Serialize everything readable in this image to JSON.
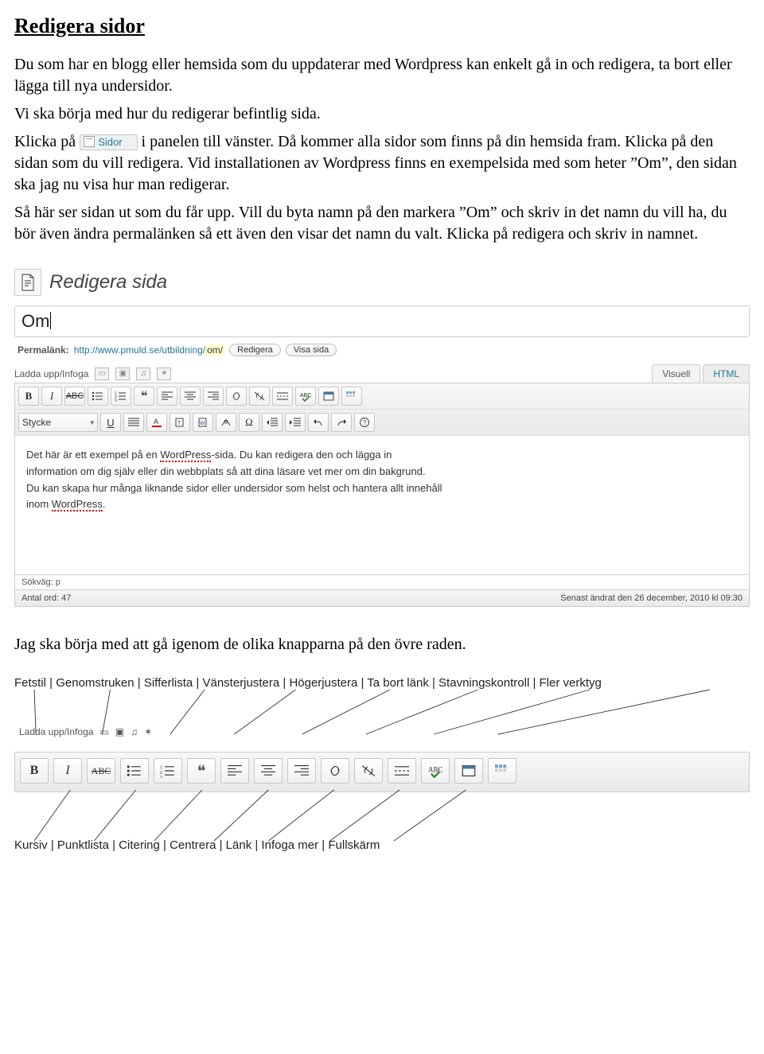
{
  "doc": {
    "heading": "Redigera sidor",
    "p1": "Du som  har en blogg eller hemsida som du uppdaterar med Wordpress kan enkelt gå in och redigera, ta bort eller lägga till nya undersidor.",
    "p2": "Vi ska börja med hur du redigerar befintlig sida.",
    "p3a": "Klicka på ",
    "sidor_chip": "Sidor",
    "p3b": " i panelen till vänster. Då kommer alla sidor som finns på din hemsida fram. Klicka på den sidan som du vill redigera. Vid installationen av Wordpress finns en exempelsida med som heter ”Om”, den sidan ska jag nu visa hur man redigerar.",
    "p4": "Så här ser sidan ut som du får upp. Vill du byta namn på den markera ”Om” och skriv in det namn du vill ha, du bör även ändra permalänken så ett även den visar det namn du valt. Klicka på redigera och skriv in namnet.",
    "mid": "Jag ska börja med att gå igenom de olika knapparna på den övre raden."
  },
  "wp": {
    "header_title": "Redigera sida",
    "title_value": "Om",
    "permalink_label": "Permalänk:",
    "permalink_url": "http://www.pmuld.se/utbildning/",
    "permalink_slug": "om/",
    "btn_edit": "Redigera",
    "btn_view": "Visa sida",
    "upload_label": "Ladda upp/Infoga",
    "tab_visual": "Visuell",
    "tab_html": "HTML",
    "style_select": "Stycke",
    "body_l1a": "Det här är ett exempel på en ",
    "body_l1b": "WordPress",
    "body_l1c": "-sida. Du kan redigera den och lägga in",
    "body_l2": "information om dig själv eller din webbplats så att dina läsare vet mer om din bakgrund.",
    "body_l3": "Du kan skapa hur många liknande sidor eller undersidor som helst och hantera allt innehåll",
    "body_l4a": "inom ",
    "body_l4b": "WordPress",
    "body_l4c": ".",
    "path": "Sökväg: p",
    "wordcount": "Antal ord: 47",
    "lastmod": "Senast ändrat den 26 december, 2010 kl 09:30"
  },
  "labels_top": "Fetstil | Genomstruken | Sifferlista | Vänsterjustera | Högerjustera | Ta bort länk | Stavningskontroll | Fler verktyg",
  "labels_bottom": "Kursiv | Punktlista | Citering | Centrera | Länk | Infoga mer | Fullskärm"
}
